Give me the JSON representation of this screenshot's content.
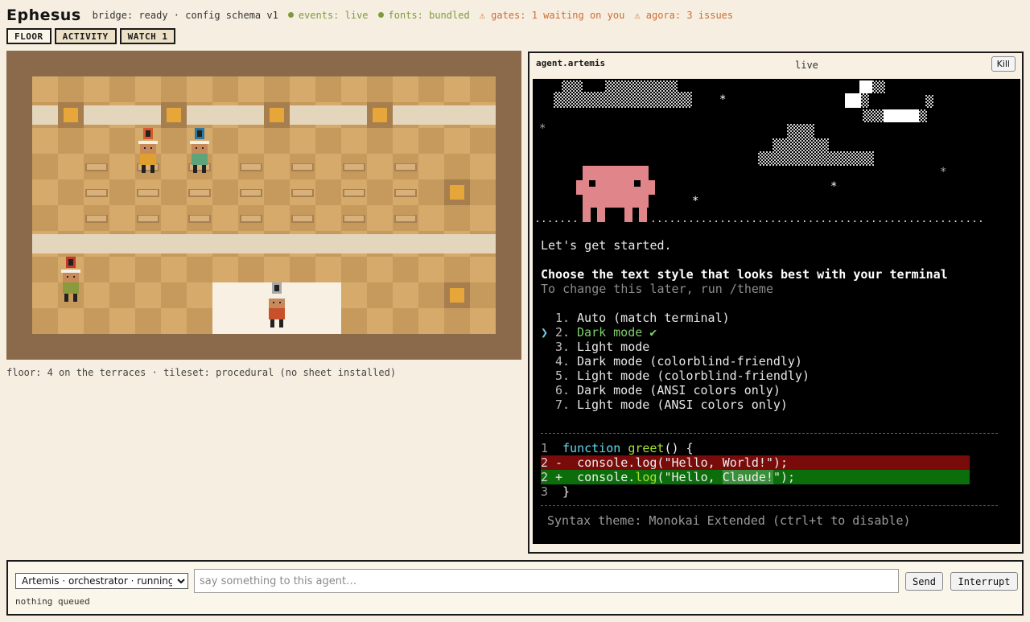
{
  "app": {
    "title": "Ephesus",
    "status": {
      "bridge": "bridge: ready · config schema v1",
      "events": "events: live",
      "fonts": "fonts: bundled",
      "gates": "⚠ gates: 1 waiting on you",
      "agora": "⚠ agora: 3 issues"
    },
    "colors": {
      "ok": "#7f9a3c",
      "warn": "#cf6a33"
    }
  },
  "tabs": [
    {
      "label": "FLOOR"
    },
    {
      "label": "ACTIVITY"
    },
    {
      "label": "WATCH 1"
    }
  ],
  "floor": {
    "caption": "floor: 4 on the terraces · tileset: procedural (no sheet installed)",
    "agents": [
      {
        "badge": "orange",
        "shirt": "#e0a030"
      },
      {
        "badge": "blue",
        "shirt": "#5ea37a"
      },
      {
        "badge": "red",
        "shirt": "#8a9a3c"
      },
      {
        "badge": "grey",
        "shirt": "#c8502a"
      }
    ]
  },
  "panel": {
    "title": "agent.artemis",
    "status": "live",
    "kill_label": "Kill",
    "terminal": {
      "intro": "Let's get started.",
      "heading": "Choose the text style that looks best with your terminal",
      "hint": "To change this later, run /theme",
      "options": [
        {
          "num": "1.",
          "label": "Auto (match terminal)"
        },
        {
          "num": "2.",
          "label": "Dark mode ✔"
        },
        {
          "num": "3.",
          "label": "Light mode"
        },
        {
          "num": "4.",
          "label": "Dark mode (colorblind-friendly)"
        },
        {
          "num": "5.",
          "label": "Light mode (colorblind-friendly)"
        },
        {
          "num": "6.",
          "label": "Dark mode (ANSI colors only)"
        },
        {
          "num": "7.",
          "label": "Light mode (ANSI colors only)"
        }
      ],
      "selected_index": 1,
      "caret": "❯",
      "code": {
        "l1_num": "1",
        "l1_kw": "function",
        "l1_fn": "greet",
        "l1_rest": "() {",
        "l2_num": "2",
        "l2_del_mark": "-",
        "l2_del_text": "console.log(\"Hello, World!\");",
        "l2_add_mark": "+",
        "l2_add_pre": "console.",
        "l2_add_fn": "log",
        "l2_add_mid": "(\"Hello, ",
        "l2_add_hl": "Claude!",
        "l2_add_end": "\");",
        "l3_num": "3",
        "l3_text": "}"
      },
      "footer": "Syntax theme: Monokai Extended (ctrl+t to disable)"
    }
  },
  "composer": {
    "selected_agent": "Artemis · orchestrator · running",
    "placeholder": "say something to this agent…",
    "send_label": "Send",
    "interrupt_label": "Interrupt",
    "queue": "nothing queued"
  }
}
